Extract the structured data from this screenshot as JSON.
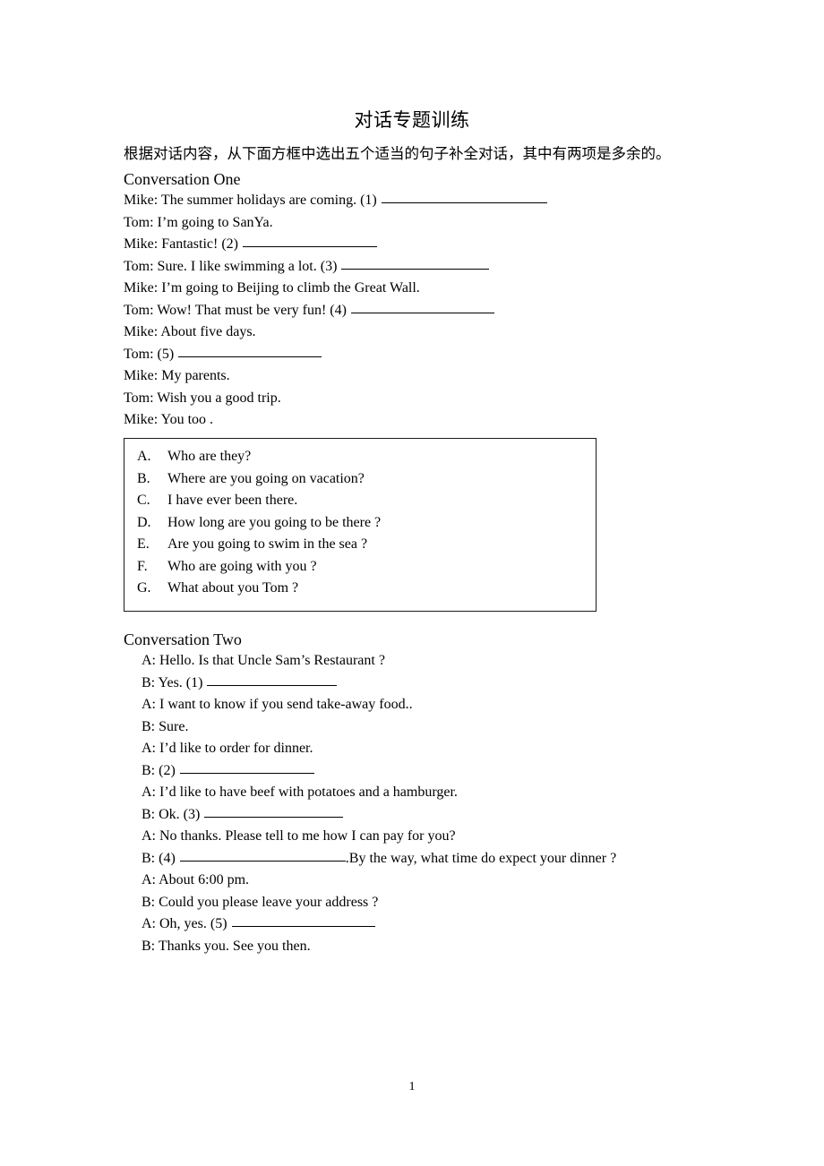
{
  "document": {
    "title": "对话专题训练",
    "instruction": "根据对话内容，从下面方框中选出五个适当的句子补全对话，其中有两项是多余的。",
    "page_number": "1"
  },
  "conversation_one": {
    "heading": "Conversation One",
    "lines": [
      {
        "text": "Mike: The summer holidays are coming. (1)",
        "blank": 185,
        "trailing": ""
      },
      {
        "text": "Tom: I’m going to SanYa.",
        "blank": 0,
        "trailing": ""
      },
      {
        "text": "Mike: Fantastic! (2)",
        "blank": 150,
        "trailing": ""
      },
      {
        "text": "Tom: Sure. I like swimming a lot. (3)",
        "blank": 165,
        "trailing": ""
      },
      {
        "text": "Mike: I’m going to Beijing to climb the Great Wall.",
        "blank": 0,
        "trailing": ""
      },
      {
        "text": "Tom: Wow! That must be very fun! (4)",
        "blank": 160,
        "trailing": ""
      },
      {
        "text": "Mike: About five days.",
        "blank": 0,
        "trailing": ""
      },
      {
        "text": "Tom: (5)",
        "blank": 160,
        "trailing": ""
      },
      {
        "text": "Mike: My parents.",
        "blank": 0,
        "trailing": ""
      },
      {
        "text": "Tom: Wish you a good trip.",
        "blank": 0,
        "trailing": ""
      },
      {
        "text": "Mike: You too .",
        "blank": 0,
        "trailing": ""
      }
    ]
  },
  "options_box": {
    "options": [
      {
        "letter": "A.",
        "text": "Who are they?"
      },
      {
        "letter": "B.",
        "text": "Where are you going on vacation?"
      },
      {
        "letter": "C.",
        "text": "I have ever been there."
      },
      {
        "letter": "D.",
        "text": "How long are you going to be there ?"
      },
      {
        "letter": "E.",
        "text": "Are you going to swim in the sea ?"
      },
      {
        "letter": "F.",
        "text": "Who are going with you ?"
      },
      {
        "letter": "G.",
        "text": "What about you Tom ?"
      }
    ]
  },
  "conversation_two": {
    "heading": "Conversation Two",
    "lines": [
      {
        "text": "A: Hello. Is that Uncle Sam’s Restaurant ?",
        "blank": 0,
        "trailing": ""
      },
      {
        "text": "B: Yes. (1)",
        "blank": 145,
        "trailing": ""
      },
      {
        "text": "A: I want to know if you send take-away food..",
        "blank": 0,
        "trailing": ""
      },
      {
        "text": "B: Sure.",
        "blank": 0,
        "trailing": ""
      },
      {
        "text": "A: I’d like to order for dinner.",
        "blank": 0,
        "trailing": ""
      },
      {
        "text": "B: (2)",
        "blank": 150,
        "trailing": ""
      },
      {
        "text": "A: I’d like to have beef with potatoes and a hamburger.",
        "blank": 0,
        "trailing": ""
      },
      {
        "text": "B: Ok. (3)",
        "blank": 155,
        "trailing": ""
      },
      {
        "text": "A: No thanks. Please tell to me how I can pay for you?",
        "blank": 0,
        "trailing": ""
      },
      {
        "text": "B: (4)",
        "blank": 185,
        "trailing": ".By the way, what time do expect your dinner ?"
      },
      {
        "text": "A: About 6:00 pm.",
        "blank": 0,
        "trailing": ""
      },
      {
        "text": "B: Could you please leave your address ?",
        "blank": 0,
        "trailing": ""
      },
      {
        "text": "A: Oh, yes. (5)",
        "blank": 160,
        "trailing": ""
      },
      {
        "text": "B: Thanks you. See you then.",
        "blank": 0,
        "trailing": ""
      }
    ]
  }
}
